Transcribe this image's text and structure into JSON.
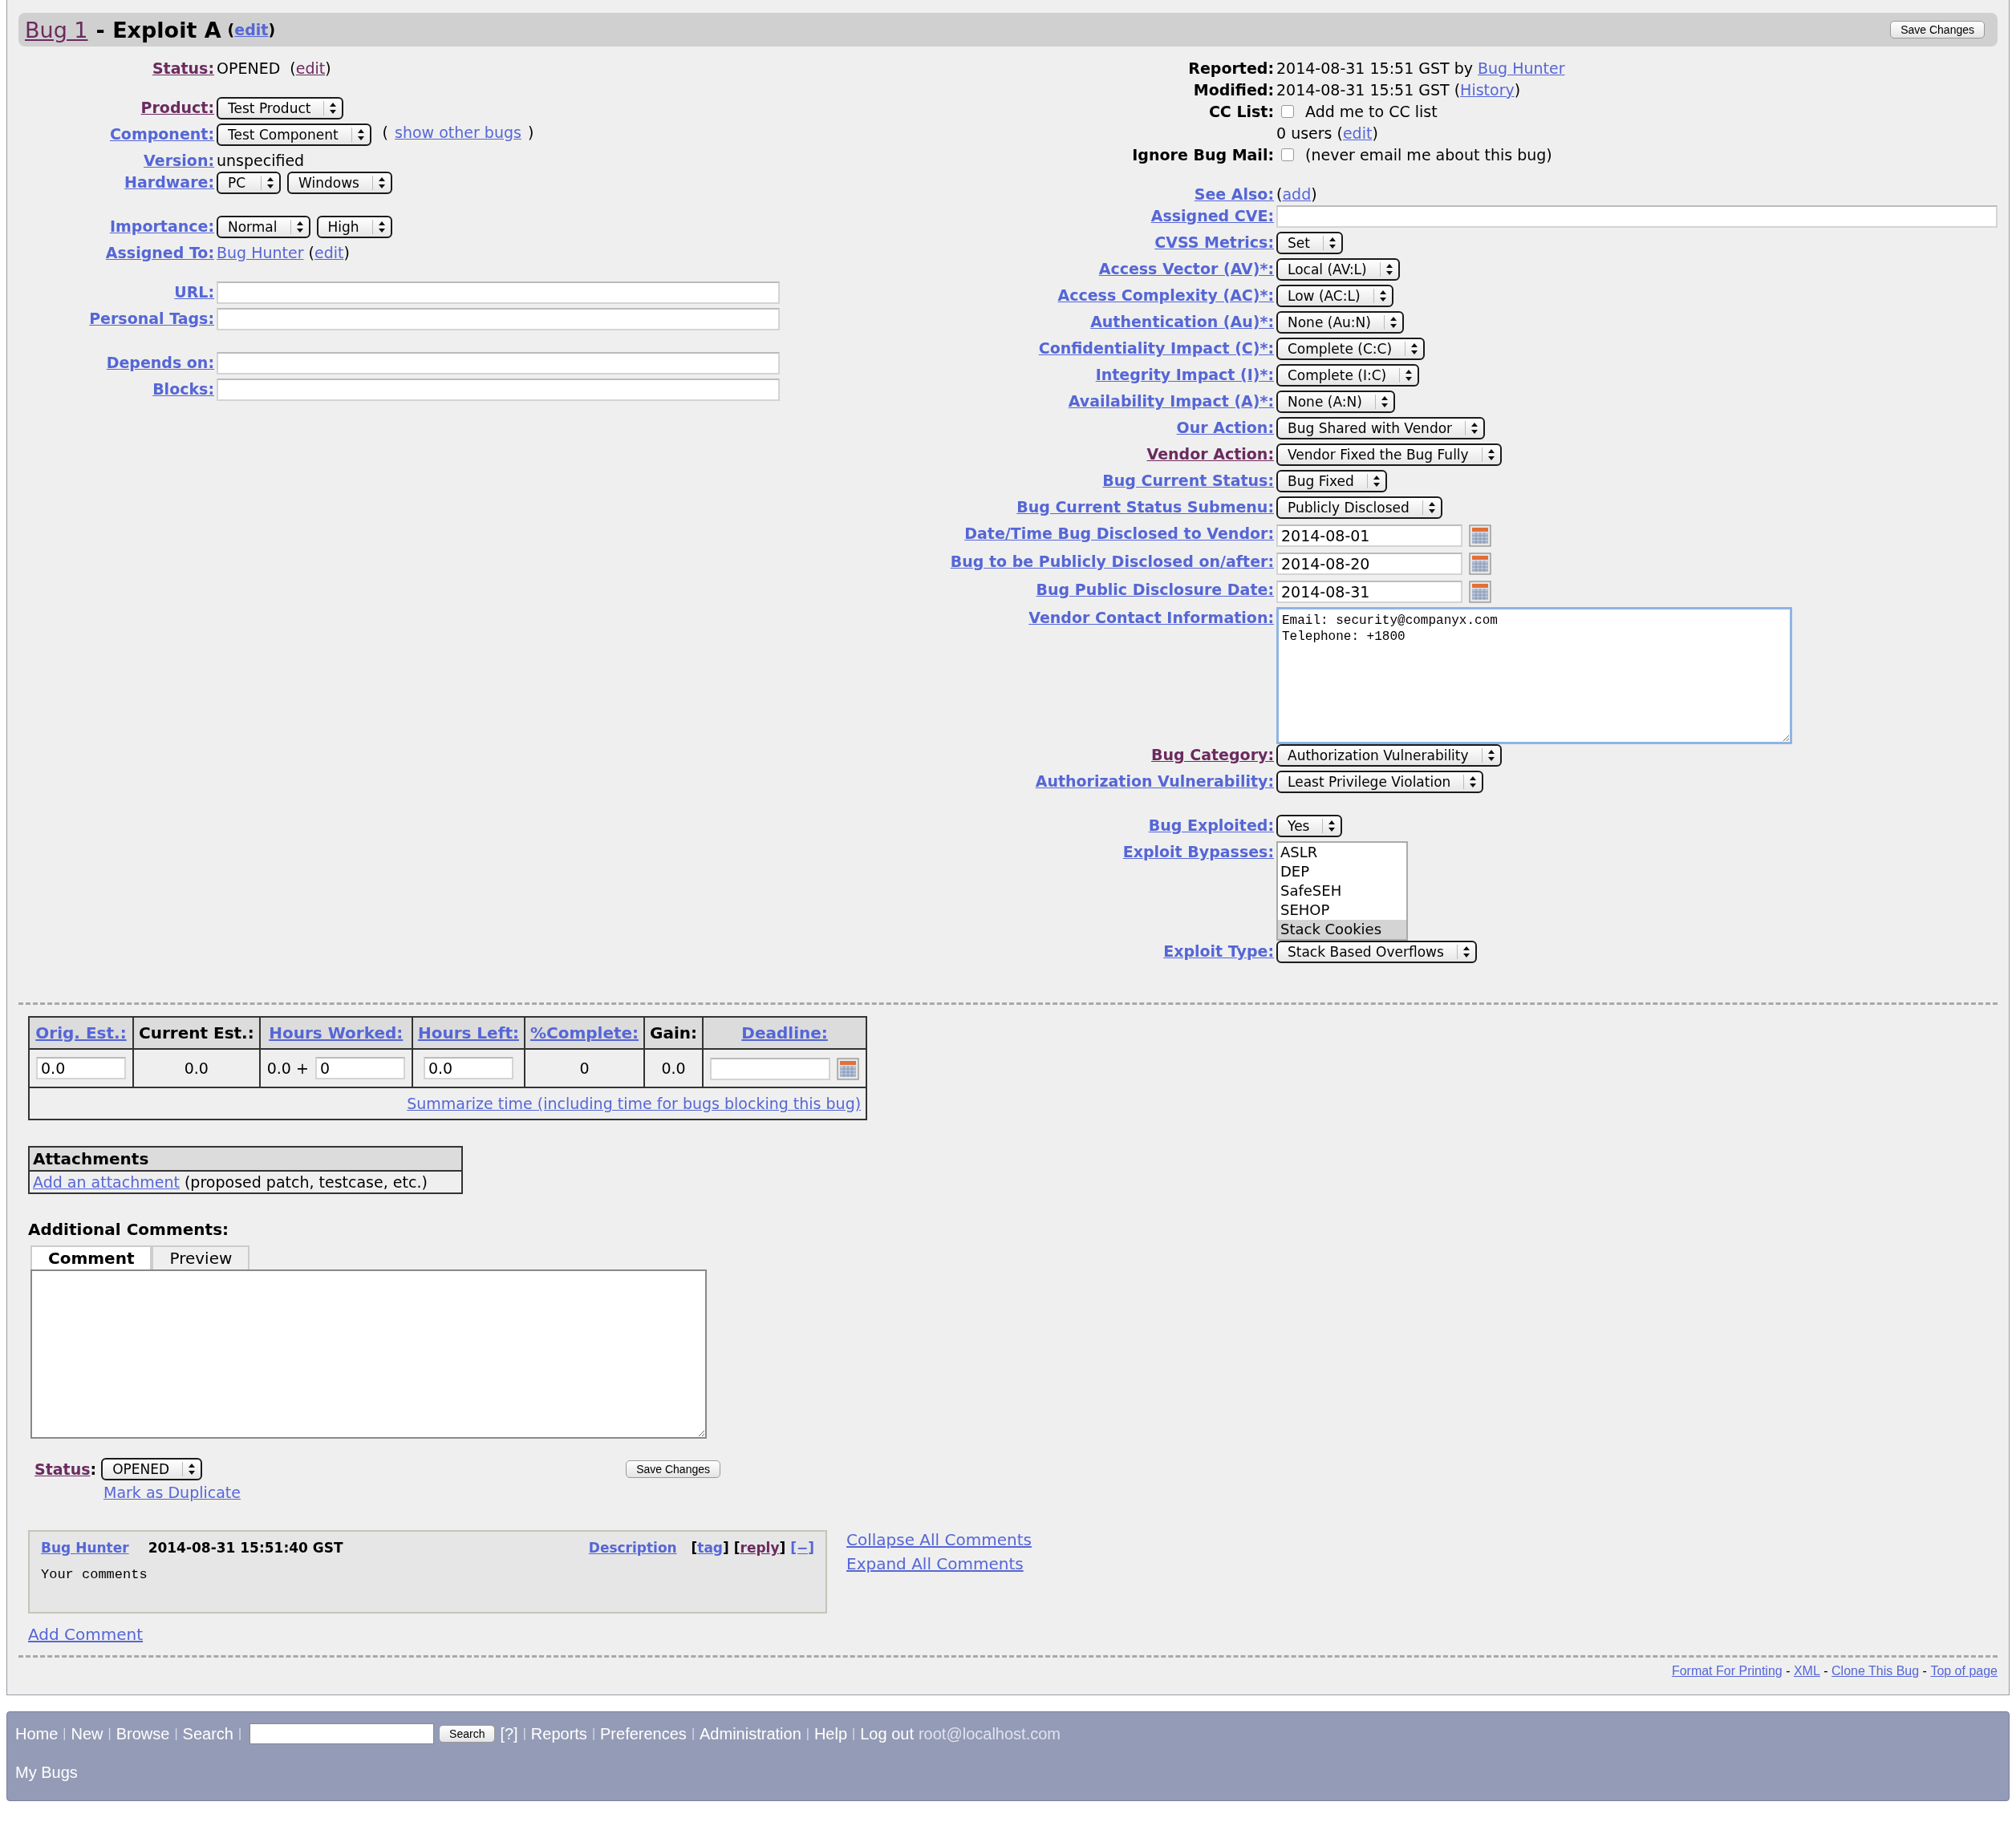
{
  "title": {
    "bug_link": "Bug 1",
    "summary": "- Exploit A",
    "edit_open": "(",
    "edit": "edit",
    "edit_close": ")"
  },
  "save_top": "Save Changes",
  "left": [
    [
      {
        "label": "Status:",
        "kind": "visited-link",
        "parts": [
          {
            "kind": "text",
            "text": "OPENED  ("
          },
          {
            "kind": "visited-link",
            "text": "edit"
          },
          {
            "kind": "text",
            "text": ")"
          }
        ]
      }
    ],
    [
      {
        "label": "Product:",
        "kind": "visited-link",
        "parts": [
          {
            "kind": "select",
            "value": "Test Product"
          }
        ]
      },
      {
        "label": "Component:",
        "kind": "link",
        "parts": [
          {
            "kind": "select",
            "value": "Test Component"
          },
          {
            "kind": "text",
            "text": " ("
          },
          {
            "kind": "link",
            "text": "show other bugs"
          },
          {
            "kind": "text",
            "text": ")"
          }
        ]
      },
      {
        "label": "Version:",
        "kind": "link",
        "parts": [
          {
            "kind": "text",
            "text": "unspecified"
          }
        ]
      },
      {
        "label": "Hardware:",
        "kind": "link",
        "parts": [
          {
            "kind": "select",
            "value": "PC"
          },
          {
            "kind": "select",
            "value": "Windows"
          }
        ]
      }
    ],
    [
      {
        "label": "Importance:",
        "kind": "link",
        "parts": [
          {
            "kind": "select",
            "value": "Normal"
          },
          {
            "kind": "select",
            "value": "High"
          }
        ]
      },
      {
        "label": "Assigned To:",
        "kind": "link",
        "parts": [
          {
            "kind": "link",
            "text": "Bug Hunter"
          },
          {
            "kind": "text",
            "text": " ("
          },
          {
            "kind": "link",
            "text": "edit"
          },
          {
            "kind": "text",
            "text": ")"
          }
        ]
      }
    ],
    [
      {
        "label": "URL:",
        "kind": "link",
        "parts": [
          {
            "kind": "input"
          }
        ]
      },
      {
        "label": "Personal Tags:",
        "kind": "link",
        "parts": [
          {
            "kind": "input"
          }
        ]
      }
    ],
    [
      {
        "label": "Depends on:",
        "kind": "link",
        "parts": [
          {
            "kind": "input"
          }
        ]
      },
      {
        "label": "Blocks:",
        "kind": "link",
        "parts": [
          {
            "kind": "input"
          }
        ]
      }
    ]
  ],
  "right": [
    [
      {
        "label": "Reported:",
        "kind": "plain",
        "parts": [
          {
            "kind": "text",
            "text": "2014-08-31 15:51 GST by "
          },
          {
            "kind": "link",
            "text": "Bug Hunter"
          }
        ]
      },
      {
        "label": "Modified:",
        "kind": "plain",
        "parts": [
          {
            "kind": "text",
            "text": "2014-08-31 15:51 GST ("
          },
          {
            "kind": "link",
            "text": "History"
          },
          {
            "kind": "text",
            "text": ")"
          }
        ]
      },
      {
        "label": "CC List:",
        "kind": "plain",
        "parts": [
          {
            "kind": "checkbox",
            "checked": false
          },
          {
            "kind": "text",
            "text": "Add me to CC list"
          }
        ]
      },
      {
        "parts": [
          {
            "kind": "text",
            "text": "0 users ("
          },
          {
            "kind": "link",
            "text": "edit"
          },
          {
            "kind": "text",
            "text": ")"
          }
        ]
      },
      {
        "label": "Ignore Bug Mail:",
        "kind": "plain",
        "parts": [
          {
            "kind": "checkbox",
            "checked": false
          },
          {
            "kind": "text",
            "text": "(never email me about this bug)"
          }
        ]
      }
    ],
    [
      {
        "label": "See Also:",
        "kind": "link",
        "parts": [
          {
            "kind": "text",
            "text": "("
          },
          {
            "kind": "link",
            "text": "add"
          },
          {
            "kind": "text",
            "text": ")"
          }
        ]
      },
      {
        "label": "Assigned CVE:",
        "kind": "link",
        "parts": [
          {
            "kind": "wide-input"
          }
        ]
      },
      {
        "label": "CVSS Metrics:",
        "kind": "link",
        "parts": [
          {
            "kind": "select",
            "value": "Set"
          }
        ]
      },
      {
        "label": "Access Vector (AV)*:",
        "kind": "link",
        "parts": [
          {
            "kind": "select",
            "value": "Local (AV:L)"
          }
        ]
      },
      {
        "label": "Access Complexity (AC)*:",
        "kind": "link",
        "parts": [
          {
            "kind": "select",
            "value": "Low (AC:L)"
          }
        ]
      },
      {
        "label": "Authentication (Au)*:",
        "kind": "link",
        "parts": [
          {
            "kind": "select",
            "value": "None (Au:N)"
          }
        ]
      },
      {
        "label": "Confidentiality Impact (C)*:",
        "kind": "link",
        "parts": [
          {
            "kind": "select",
            "value": "Complete (C:C)"
          }
        ]
      },
      {
        "label": "Integrity Impact (I)*:",
        "kind": "link",
        "parts": [
          {
            "kind": "select",
            "value": "Complete (I:C)"
          }
        ]
      },
      {
        "label": "Availability Impact (A)*:",
        "kind": "link",
        "parts": [
          {
            "kind": "select",
            "value": "None (A:N)"
          }
        ]
      },
      {
        "label": "Our Action:",
        "kind": "link",
        "parts": [
          {
            "kind": "select",
            "value": "Bug Shared with Vendor"
          }
        ]
      },
      {
        "label": "Vendor Action:",
        "kind": "visited-link",
        "parts": [
          {
            "kind": "select",
            "value": "Vendor Fixed the Bug Fully"
          }
        ]
      },
      {
        "label": "Bug Current Status:",
        "kind": "link",
        "parts": [
          {
            "kind": "select",
            "value": "Bug Fixed"
          }
        ]
      },
      {
        "label": "Bug Current Status Submenu:",
        "kind": "link",
        "parts": [
          {
            "kind": "select",
            "value": "Publicly Disclosed"
          }
        ]
      },
      {
        "label": "Date/Time Bug Disclosed to Vendor:",
        "kind": "link",
        "parts": [
          {
            "kind": "date",
            "value": "2014-08-01"
          }
        ]
      },
      {
        "label": "Bug to be Publicly Disclosed on/after:",
        "kind": "link",
        "parts": [
          {
            "kind": "date",
            "value": "2014-08-20"
          }
        ]
      },
      {
        "label": "Bug Public Disclosure Date:",
        "kind": "link",
        "parts": [
          {
            "kind": "date",
            "value": "2014-08-31"
          }
        ]
      },
      {
        "label": "Vendor Contact Information:",
        "kind": "link",
        "parts": [
          {
            "kind": "textarea",
            "lines": [
              "Email: security@companyx.com",
              "Telephone: +1800"
            ]
          }
        ]
      },
      {
        "label": "Bug Category:",
        "kind": "visited-link",
        "parts": [
          {
            "kind": "select",
            "value": "Authorization Vulnerability"
          }
        ]
      },
      {
        "label": "Authorization Vulnerability:",
        "kind": "link",
        "parts": [
          {
            "kind": "select",
            "value": "Least Privilege Violation"
          }
        ]
      }
    ],
    [
      {
        "label": "Bug Exploited:",
        "kind": "link",
        "parts": [
          {
            "kind": "select",
            "value": "Yes"
          }
        ]
      },
      {
        "label": "Exploit Bypasses:",
        "kind": "link",
        "parts": [
          {
            "kind": "listbox",
            "options": [
              {
                "text": "ASLR",
                "selected": false
              },
              {
                "text": "DEP",
                "selected": false
              },
              {
                "text": "SafeSEH",
                "selected": false
              },
              {
                "text": "SEHOP",
                "selected": false
              },
              {
                "text": "Stack Cookies",
                "selected": true
              }
            ]
          }
        ]
      },
      {
        "label": "Exploit Type:",
        "kind": "link",
        "parts": [
          {
            "kind": "select",
            "value": "Stack Based Overflows"
          }
        ]
      }
    ]
  ],
  "time_table": {
    "headers": [
      {
        "text": "Orig. Est.:",
        "kind": "link"
      },
      {
        "text": "Current Est.:",
        "kind": "plain"
      },
      {
        "text": "Hours Worked:",
        "kind": "link"
      },
      {
        "text": "Hours Left:",
        "kind": "link"
      },
      {
        "text": "%Complete:",
        "kind": "link"
      },
      {
        "text": "Gain:",
        "kind": "plain"
      },
      {
        "text": "Deadline:",
        "kind": "link"
      }
    ],
    "cells": [
      [
        {
          "kind": "input",
          "value": "0.0"
        }
      ],
      [
        {
          "kind": "text",
          "text": "0.0"
        }
      ],
      [
        {
          "kind": "text",
          "text": "0.0 + "
        },
        {
          "kind": "input",
          "value": "0"
        }
      ],
      [
        {
          "kind": "input",
          "value": "0.0"
        }
      ],
      [
        {
          "kind": "text",
          "text": "0"
        }
      ],
      [
        {
          "kind": "text",
          "text": "0.0"
        }
      ],
      [
        {
          "kind": "date"
        }
      ]
    ],
    "summarize": "Summarize time (including time for bugs blocking this bug)"
  },
  "attachments": {
    "title": "Attachments",
    "add": "Add an attachment",
    "note": " (proposed patch, testcase, etc.)"
  },
  "comment_form": {
    "label": "Additional Comments:",
    "tabs": [
      {
        "label": "Comment",
        "selected": true
      },
      {
        "label": "Preview",
        "selected": false
      }
    ],
    "status_label": "Status",
    "status_colon": ":",
    "status": "OPENED",
    "save": "Save Changes",
    "duplicate": "Mark as Duplicate"
  },
  "comment": {
    "author": "Bug Hunter",
    "time": "2014-08-31 15:51:40 GST",
    "actions": [
      {
        "kind": "link",
        "text": "Description"
      },
      {
        "kind": "text",
        "text": "   ["
      },
      {
        "kind": "link",
        "text": "tag"
      },
      {
        "kind": "text",
        "text": "] ["
      },
      {
        "kind": "visited-link",
        "text": "reply"
      },
      {
        "kind": "text",
        "text": "] "
      },
      {
        "kind": "link",
        "text": "[−]"
      }
    ],
    "body": "Your comments"
  },
  "comment_links": [
    "Collapse All Comments",
    "Expand All Comments"
  ],
  "add_comment": "Add Comment",
  "footer_links": [
    {
      "kind": "link",
      "text": "Format For Printing"
    },
    {
      "kind": "text",
      "text": " - "
    },
    {
      "kind": "link",
      "text": "XML"
    },
    {
      "kind": "text",
      "text": " - "
    },
    {
      "kind": "link",
      "text": "Clone This Bug"
    },
    {
      "kind": "text",
      "text": " - "
    },
    {
      "kind": "link",
      "text": "Top of page"
    }
  ],
  "nav": [
    [
      {
        "kind": "link",
        "text": "Home"
      },
      {
        "kind": "sep",
        "text": "|"
      },
      {
        "kind": "link",
        "text": "New"
      },
      {
        "kind": "sep",
        "text": "|"
      },
      {
        "kind": "link",
        "text": "Browse"
      },
      {
        "kind": "sep",
        "text": "|"
      },
      {
        "kind": "link",
        "text": "Search"
      },
      {
        "kind": "sep",
        "text": "|"
      },
      {
        "kind": "input"
      },
      {
        "kind": "button",
        "text": "Search"
      },
      {
        "kind": "link",
        "text": "[?]"
      },
      {
        "kind": "sep",
        "text": "|"
      },
      {
        "kind": "link",
        "text": "Reports"
      },
      {
        "kind": "sep",
        "text": "|"
      },
      {
        "kind": "link",
        "text": "Preferences"
      },
      {
        "kind": "sep",
        "text": "|"
      },
      {
        "kind": "link",
        "text": "Administration"
      },
      {
        "kind": "sep",
        "text": "|"
      },
      {
        "kind": "link",
        "text": "Help"
      },
      {
        "kind": "sep",
        "text": "|"
      },
      {
        "kind": "link",
        "text": "Log out"
      },
      {
        "kind": "user",
        "text": "root@localhost.com"
      }
    ],
    [
      {
        "kind": "link",
        "text": "My Bugs"
      }
    ]
  ]
}
